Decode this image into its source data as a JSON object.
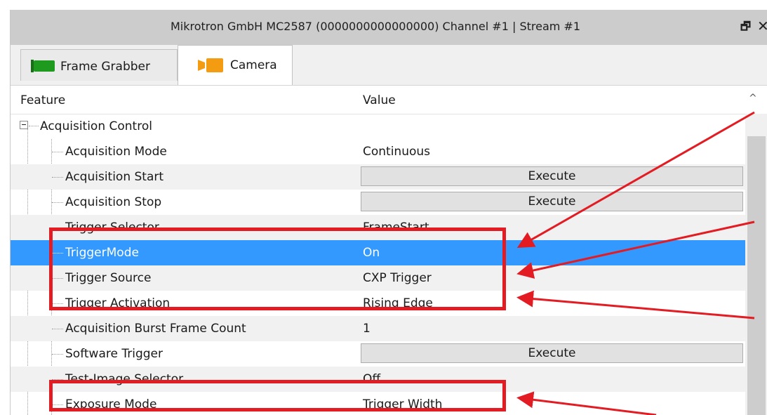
{
  "window": {
    "title": "Mikrotron GmbH MC2587 (0000000000000000) Channel #1 | Stream #1",
    "float_icon": "🗗",
    "close_icon": "✕"
  },
  "tabs": [
    {
      "label": "Frame Grabber",
      "icon": "green-board-icon",
      "active": false
    },
    {
      "label": "Camera",
      "icon": "orange-camera-icon",
      "active": true
    }
  ],
  "table": {
    "columns": [
      "Feature",
      "Value"
    ],
    "group": {
      "label": "Acquisition Control"
    },
    "rows": [
      {
        "feature": "Acquisition Mode",
        "value": "Continuous"
      },
      {
        "feature": "Acquisition Start",
        "value": "Execute",
        "button": true
      },
      {
        "feature": "Acquisition Stop",
        "value": "Execute",
        "button": true
      },
      {
        "feature": "Trigger Selector",
        "value": "FrameStart"
      },
      {
        "feature": "TriggerMode",
        "value": "On",
        "selected": true
      },
      {
        "feature": "Trigger Source",
        "value": "CXP Trigger"
      },
      {
        "feature": "Trigger Activation",
        "value": "Rising Edge"
      },
      {
        "feature": "Acquisition Burst Frame Count",
        "value": "1"
      },
      {
        "feature": "Software Trigger",
        "value": "Execute",
        "button": true
      },
      {
        "feature": "Test-Image Selector",
        "value": "Off"
      },
      {
        "feature": "Exposure Mode",
        "value": "Trigger Width"
      }
    ]
  },
  "colors": {
    "selection": "#3399ff",
    "highlight": "#e31b23",
    "frame_grabber_icon": "#1e9b1e",
    "camera_icon": "#f39c12"
  }
}
